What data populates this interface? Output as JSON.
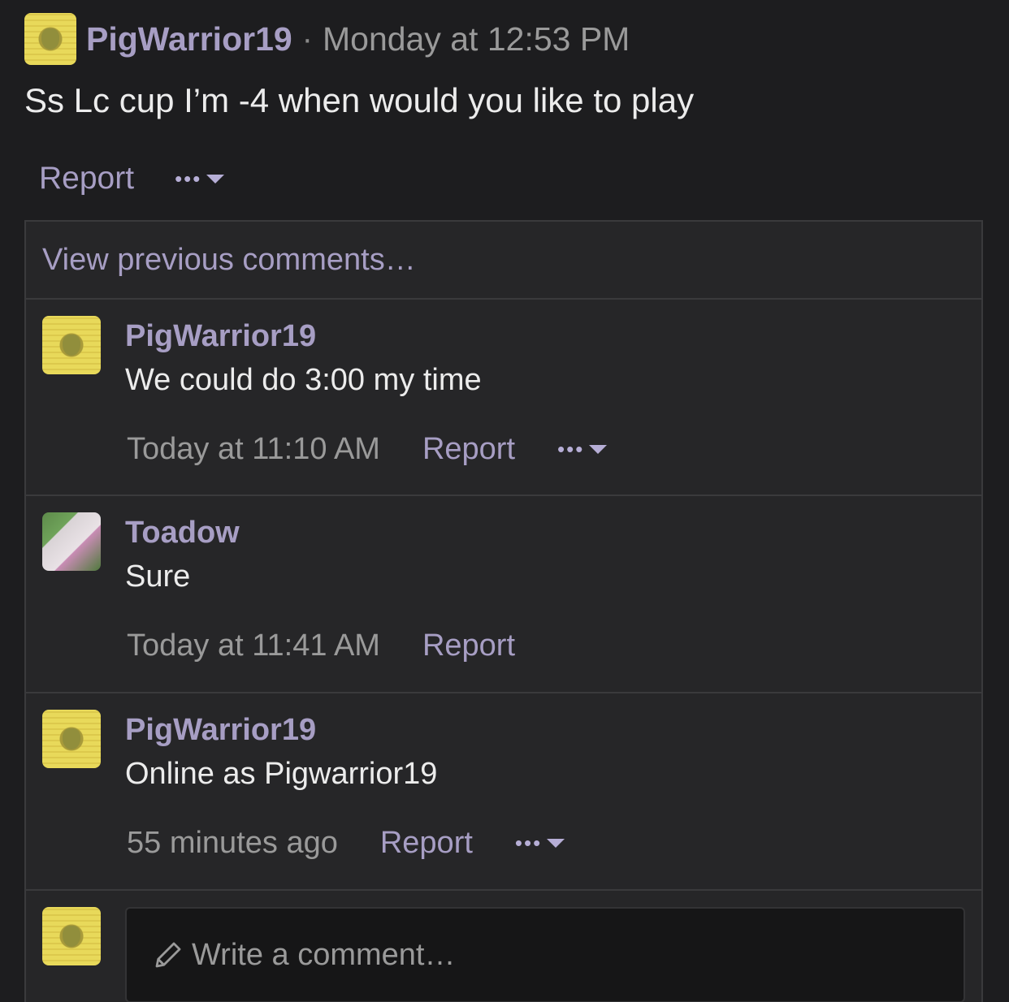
{
  "post": {
    "author": "PigWarrior19",
    "separator": "·",
    "time": "Monday at 12:53 PM",
    "body": "Ss Lc cup I’m -4 when would you like to play",
    "report_label": "Report"
  },
  "comments_section": {
    "view_previous": "View previous comments…",
    "comments": [
      {
        "author": "PigWarrior19",
        "text": "We could do 3:00 my time",
        "time": "Today at 11:10 AM",
        "report_label": "Report",
        "has_more_menu": true
      },
      {
        "author": "Toadow",
        "text": "Sure",
        "time": "Today at 11:41 AM",
        "report_label": "Report",
        "has_more_menu": false
      },
      {
        "author": "PigWarrior19",
        "text": "Online as Pigwarrior19",
        "time": "55 minutes ago",
        "report_label": "Report",
        "has_more_menu": true
      }
    ],
    "write_placeholder": "Write a comment…"
  },
  "colors": {
    "background": "#1d1d1f",
    "accent_link": "#a79ec4",
    "muted_text": "#9a9a9a"
  },
  "icons": {
    "more_menu": "ellipsis-caret-icon",
    "write": "pencil-icon"
  }
}
